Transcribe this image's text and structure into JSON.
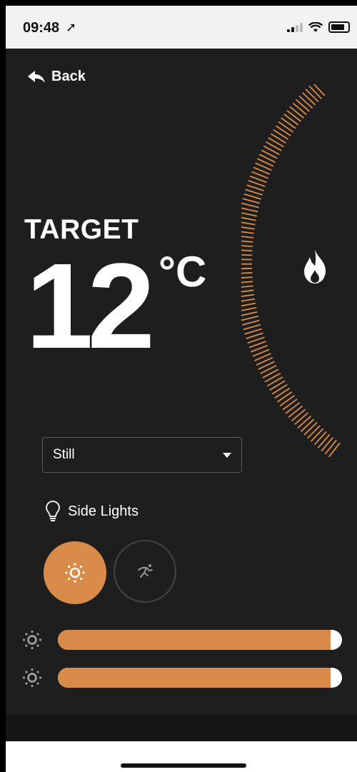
{
  "status_bar": {
    "time": "09:48",
    "location_icon": "location-arrow-icon"
  },
  "nav": {
    "back_label": "Back"
  },
  "thermostat": {
    "label": "TARGET",
    "temperature": "12",
    "unit": "°C",
    "flame_icon": "flame-icon"
  },
  "mode_select": {
    "selected": "Still"
  },
  "lights": {
    "label": "Side Lights",
    "mode_on_icon": "sun-icon",
    "mode_off_icon": "running-person-icon"
  },
  "sliders": [
    {
      "value_percent": 96,
      "icon": "brightness-icon"
    },
    {
      "value_percent": 96,
      "icon": "brightness-icon"
    }
  ],
  "colors": {
    "accent": "#d98b4a",
    "background": "#1e1e1e",
    "text": "#ffffff"
  }
}
